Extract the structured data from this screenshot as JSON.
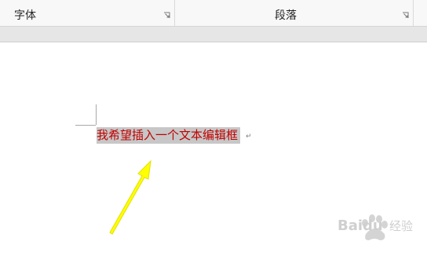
{
  "ribbon": {
    "groups": [
      {
        "label": "字体",
        "launcher": "dialog-launcher-icon"
      },
      {
        "label": "段落",
        "launcher": "dialog-launcher-icon"
      }
    ]
  },
  "document": {
    "selected_text": "我希望插入一个文本编辑框",
    "paragraph_mark": "↵",
    "text_color": "#c00000",
    "selection_color": "#c7c7c7"
  },
  "annotation": {
    "arrow_color": "#ffff00",
    "arrow_icon": "arrow-up-right-icon"
  },
  "watermark": {
    "brand": "Baidu",
    "text": "经验",
    "logo": "paw-logo-icon"
  }
}
